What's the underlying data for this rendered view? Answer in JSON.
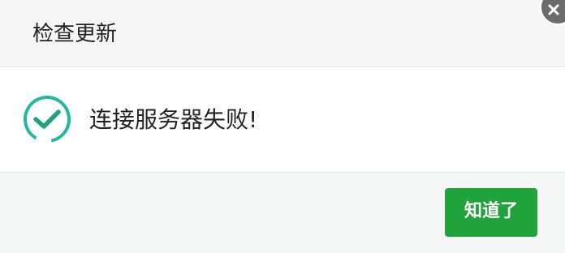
{
  "dialog": {
    "title": "检查更新",
    "message": "连接服务器失败!",
    "ok_label": "知道了",
    "status_icon": "check-circle-icon",
    "close_icon": "close-icon"
  },
  "colors": {
    "accent": "#1fa33a",
    "icon_teal": "#1fb8a0"
  }
}
